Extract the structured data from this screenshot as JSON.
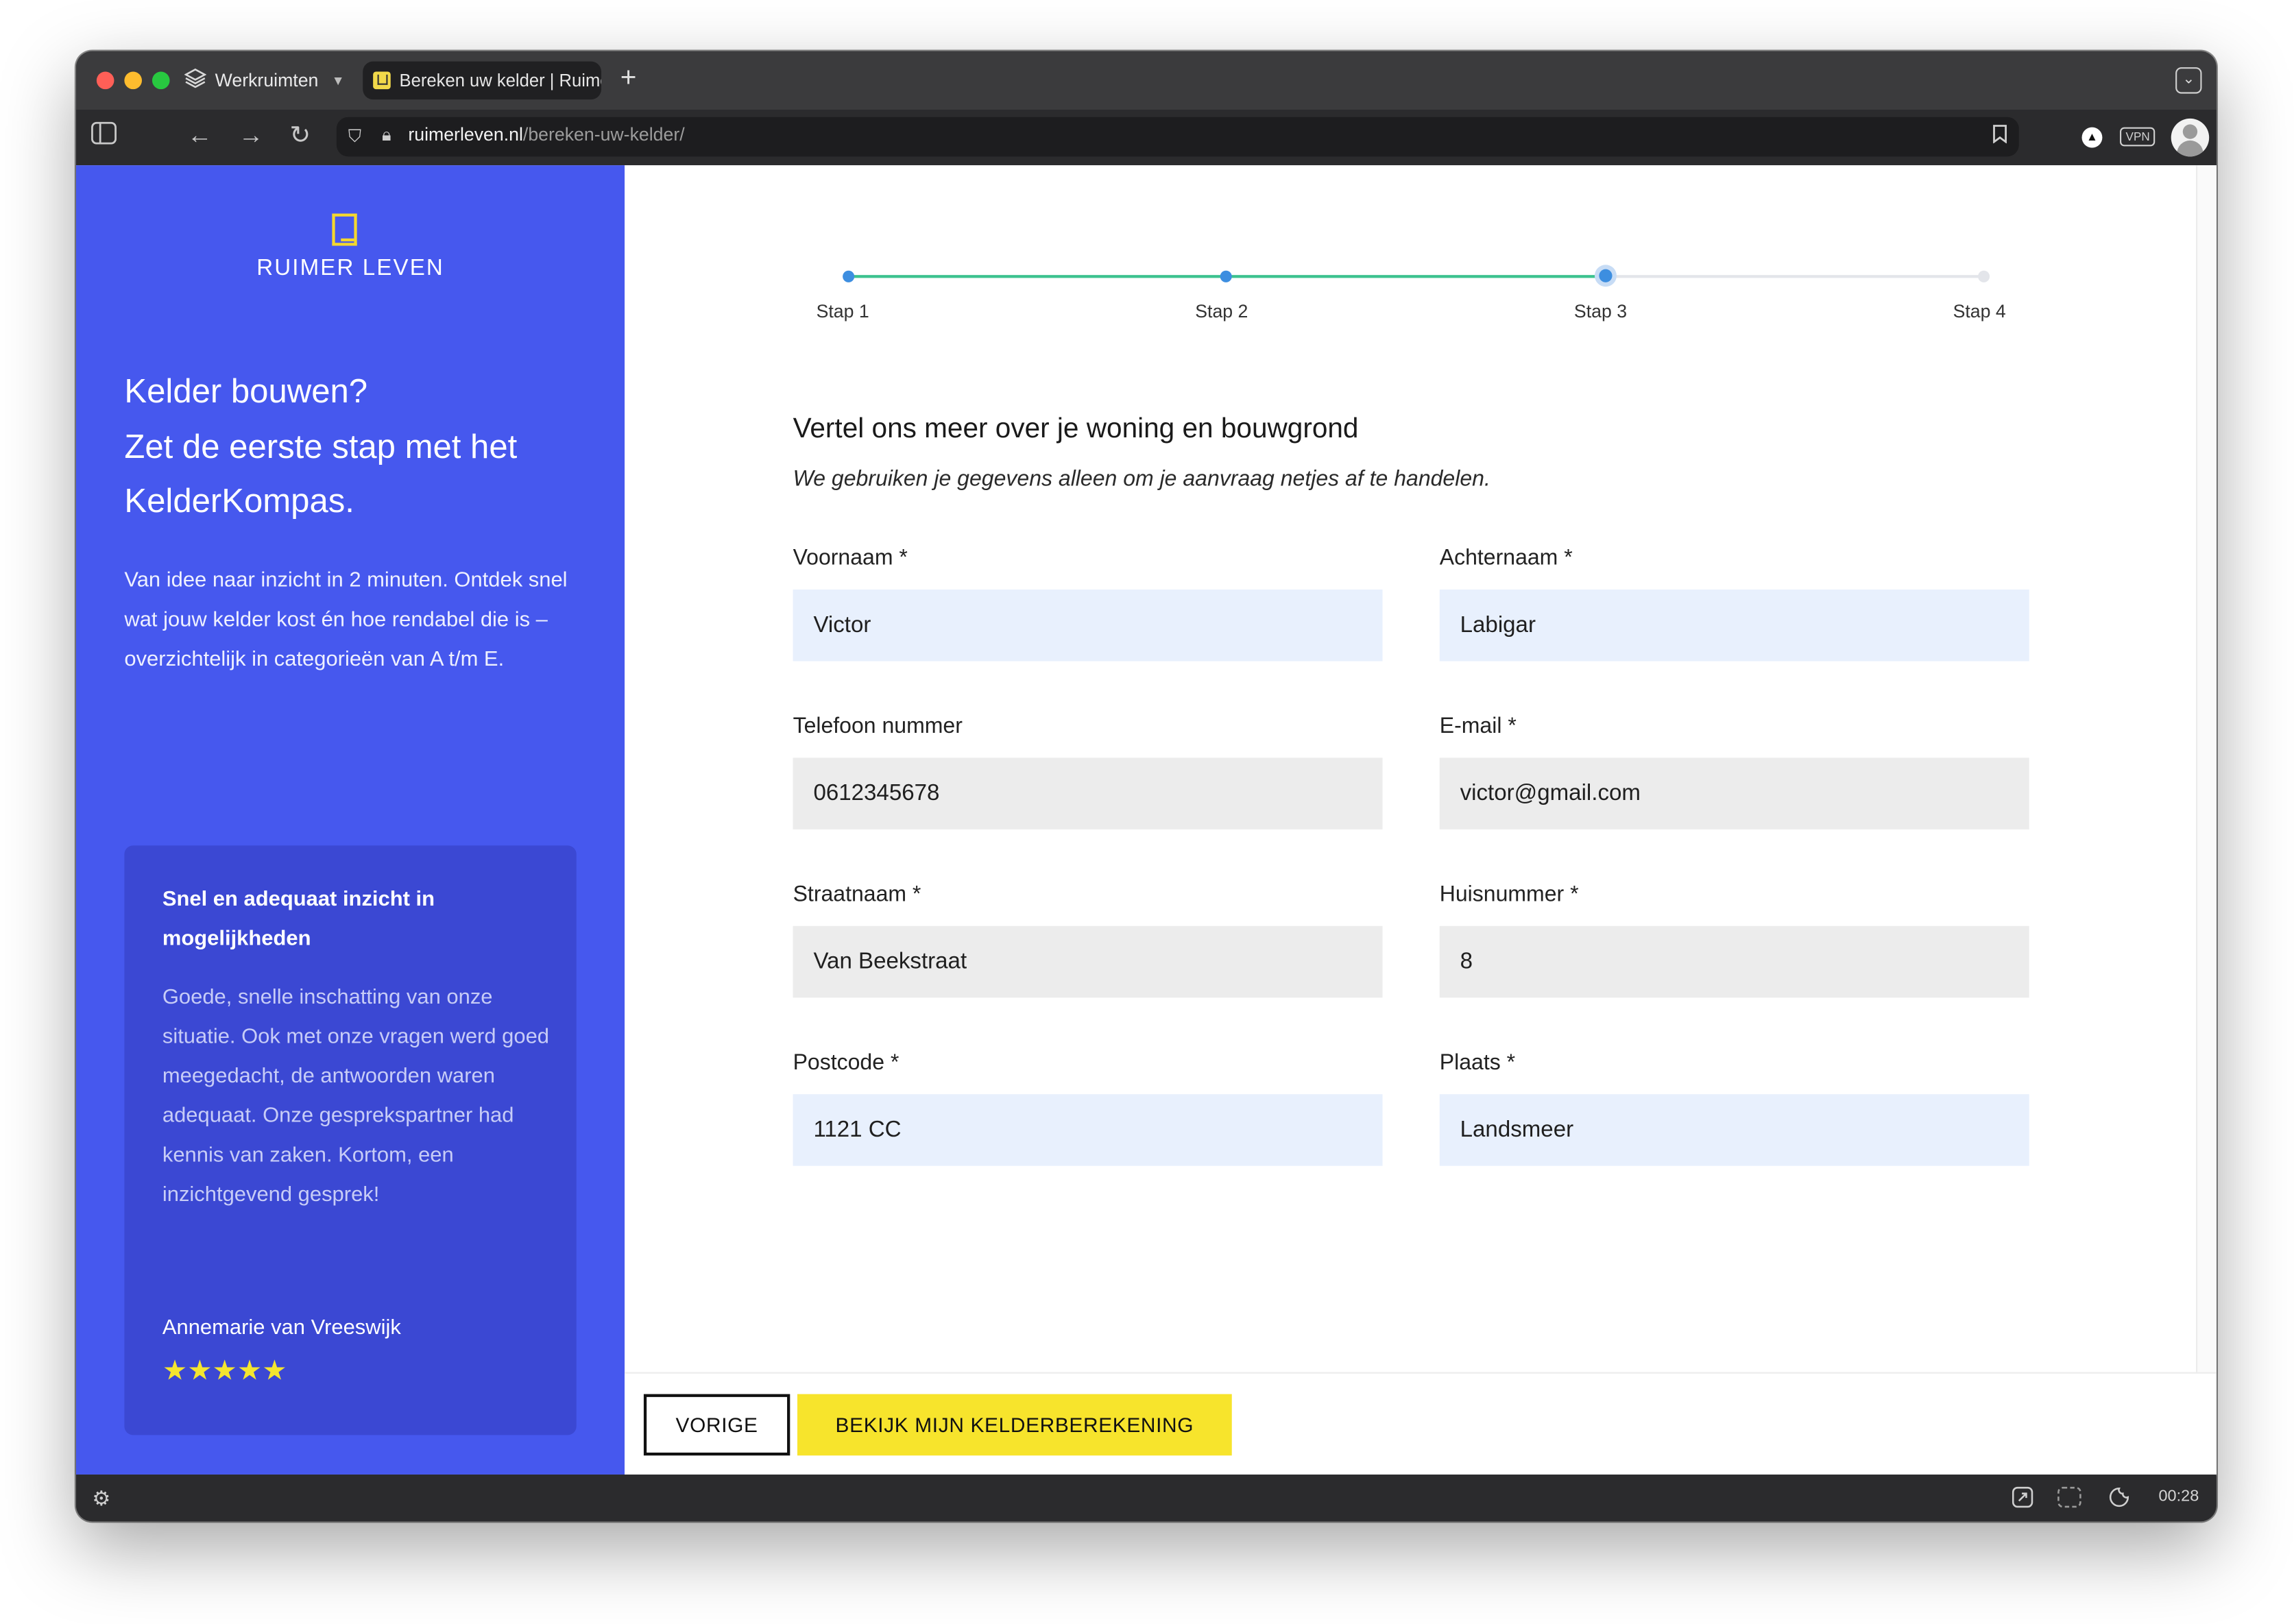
{
  "browser": {
    "workspace_label": "Werkruimten",
    "tab_title": "Bereken uw kelder | Ruimer Leven",
    "new_tab_symbol": "+",
    "url_domain": "ruimerleven.nl",
    "url_path": "/bereken-uw-kelder/",
    "vpn_label": "VPN",
    "clock": "00:28"
  },
  "sidebar": {
    "logo_text": "RUIMER LEVEN",
    "heading_line1": "Kelder bouwen?",
    "heading_line2": "Zet de eerste stap met het KelderKompas.",
    "intro": "Van idee naar inzicht in 2 minuten. Ontdek snel wat jouw kelder kost én hoe rendabel die is – overzichtelijk in categorieën van A t/m E.",
    "testimonial": {
      "title": "Snel en adequaat inzicht in mogelijkheden",
      "text": "Goede, snelle inschatting van onze situatie. Ook met onze vragen werd goed meegedacht, de antwoorden waren adequaat. Onze gesprekspartner had kennis van zaken. Kortom, een inzichtgevend gesprek!",
      "author": "Annemarie van Vreeswijk",
      "stars": "★★★★★",
      "rating": 5,
      "rating_max": 5
    }
  },
  "progress": {
    "steps": [
      "Stap 1",
      "Stap 2",
      "Stap 3",
      "Stap 4"
    ],
    "current_step": 3
  },
  "form": {
    "title": "Vertel ons meer over je woning en bouwgrond",
    "subtitle": "We gebruiken je gegevens alleen om je aanvraag netjes af te handelen.",
    "fields": {
      "first_name": {
        "label": "Voornaam *",
        "value": "Victor"
      },
      "last_name": {
        "label": "Achternaam *",
        "value": "Labigar"
      },
      "phone": {
        "label": "Telefoon nummer",
        "value": "0612345678"
      },
      "email": {
        "label": "E-mail *",
        "value": "victor@gmail.com"
      },
      "street": {
        "label": "Straatnaam *",
        "value": "Van Beekstraat"
      },
      "house_number": {
        "label": "Huisnummer *",
        "value": "8"
      },
      "postcode": {
        "label": "Postcode *",
        "value": "1121 CC"
      },
      "city": {
        "label": "Plaats *",
        "value": "Landsmeer"
      }
    }
  },
  "actions": {
    "previous_label": "VORIGE",
    "submit_label": "BEKIJK MIJN KELDERBEREKENING"
  },
  "colors": {
    "sidebar_bg": "#4658ee",
    "card_bg": "#3b48d3",
    "accent_yellow": "#f7e42c",
    "progress_done": "#3cc28f",
    "step_dot": "#3d8ee0"
  }
}
